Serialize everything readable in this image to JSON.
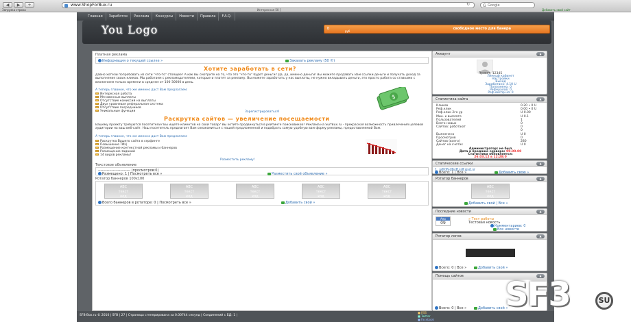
{
  "browser": {
    "nav": [
      "◀",
      "▶",
      "+"
    ],
    "url": "www.ShopForBux.ru",
    "search_placeholder": "Google",
    "status": "Загрузка строка",
    "tab_title": "Интересная 50 ]",
    "bookmark": "Добавить свой сайт"
  },
  "site": {
    "menu": [
      "Главная",
      "Заработок",
      "Реклама",
      "Конкурсы",
      "Новости",
      "Правила",
      "F.A.Q."
    ],
    "logo": "You Logo",
    "banner": {
      "left": "Б",
      "sub": "руб",
      "right": "свободное место для банера"
    }
  },
  "main": {
    "paid_title": "Платная реклама",
    "info_link": "Информация о текущей ссылке »",
    "order_link": "Заказать рекламу (50 ©)",
    "earn_title": "Хотите заработать в сети?",
    "earn_para": "Давно хотели попробовать из сети \"что-то\" стоящее? А как Вы смотрите на то, что это \"что-то\" будет деньги? Да, да, именно деньги! Вы можете продавать Вам ссылки деньги и получать доход за выполнение своих кликов. Мы работаем с рекламодателями, которые и платят за рекламу. Вы можете заработать у нас выплаты, не нужно вкладывать деньги, это просто работа со ставками с вложением только времени в среднем от 100-30000 в день.",
    "earn_link": "А теперь главное, что же именно даст Вам предлагаем:",
    "earn_bullets": [
      "Интересная работа",
      "Мгновенные выплаты",
      "Отсутствие комиссий на выплаты",
      "Двух уровневая реферальная система",
      "Отсутствие посредников",
      "Уникальные функции"
    ],
    "earn_cta": "Зарегистрироваться!",
    "promo_title": "Раскрутка сайтов — увеличение посещаемости",
    "promo_para": "Вашему проекту требуются посетители? Вы ищете клиентов на свой товар? Вы хотите продвинуться в рейтинге поисковиков? Реклама на SurfBux.ru - прекрасная возможность привлечения целевой аудитории на ваш веб-сайт. Наш посетитель предлагает Вам ознакомиться с нашей предложенной и подобрать самую удобную вам форму рекламы, предоставляемой Вам.",
    "promo_link": "А теперь главное, что же именно даст Вам предлагаем:",
    "promo_bullets": [
      "Раскрутка Вашего сайта в серфинге",
      "Повышение ТИЦ",
      "Размещение контекстной рекламы и баннеров",
      "Размещение заданий",
      "14 видов рекламы!"
    ],
    "promo_cta": "Разместить рекламу!",
    "text_title": "Текстовое объявление",
    "text_line": "-------------------------- (просмотров:0)",
    "placements": "Размещено: 1 | Посмотреть все »",
    "place_link": "Разместить своё объявление »",
    "rotator_title": "Ротатор баннеров 100х100",
    "banners": [
      {
        "a": "ABC",
        "b": "текст",
        "c": "код"
      },
      {
        "a": "ABC",
        "b": "текст",
        "c": "код"
      },
      {
        "a": "ABC",
        "b": "текст",
        "c": "код"
      },
      {
        "a": "ABC",
        "b": "текст",
        "c": "код"
      },
      {
        "a": "ABC",
        "b": "текст",
        "c": "код"
      }
    ],
    "rot_count": "Всего баннеров в ротаторе: 0 | Посмотреть все »",
    "rot_add": "Добавить свой »"
  },
  "sidebar": {
    "account_title": "Аккаунт",
    "greet": "Привет, 12345",
    "acc_links": [
      "Личный кабинет",
      "Настройки",
      "Выход",
      "Заработано: 4.10 U",
      "Пополнено: 0",
      "Рефералов: 0",
      "Реф.воспр.ня: 0"
    ],
    "stats_title": "Статистика сайта",
    "stats": [
      {
        "k": "Кликов",
        "v": "0.20 • 0 U"
      },
      {
        "k": "Реф.клик",
        "v": "0.00 • 0 U"
      },
      {
        "k": "Реф.клик 2го ур",
        "v": "U 0.00"
      },
      {
        "k": "Мин. к выплате",
        "v": "U 0.1"
      },
      {
        "k": "Пользователей",
        "v": "1"
      },
      {
        "k": "Всего новых",
        "v": "0"
      },
      {
        "k": "Сайтов: работают",
        "v": "0"
      },
      {
        "k": "",
        "v": "0"
      },
      {
        "k": "Выплачено",
        "v": "U 0"
      },
      {
        "k": "Просмотров",
        "v": "0"
      },
      {
        "k": "Сайтов (всего)",
        "v": "280"
      },
      {
        "k": "Денег на счетах",
        "v": "U 0"
      }
    ],
    "admin": "Администратор: не был",
    "last_login": "Дата в продаже сервера:",
    "last_date": "00.00.00",
    "upd": "Статистика обновляется:",
    "upd_date": "26.03.12 в 12:28:0",
    "links_title": "Статические ссылки",
    "links_line": "1. sdfdfsdfsdf.sdf.gsd.sr",
    "links_all": "Всего: 1 | Все »",
    "links_add": "Добавить свою »",
    "rotator_title": "Ротатор баннеров",
    "rotator_add": "Добавить свой | Все »",
    "news_title": "Последние новости",
    "news_month": "Апр",
    "news_day": "09",
    "news_head": "Тест работы",
    "news_sub": "Тестовая новость",
    "news_comm": "Комментариев: 0",
    "news_all": "Все новости",
    "logo_title": "Ротатор логов",
    "logo_count": "Всего: 0 | Все »",
    "logo_add": "Добавить свой »",
    "note_title": "Помощь сайтов",
    "note_count": "Всего: 0 | Все »",
    "note_add": "Добавить свой »"
  },
  "footer": {
    "text": "SFB-Box.ru © 2010 | SFB | 27 | Страница сгенерирована за 0.00744 секунд | Соединений с БД: 1 |",
    "icons": [
      "RSS",
      "Twitter",
      "Facebook"
    ]
  },
  "watermark": {
    "text": "SF3",
    "badge": "SU"
  }
}
